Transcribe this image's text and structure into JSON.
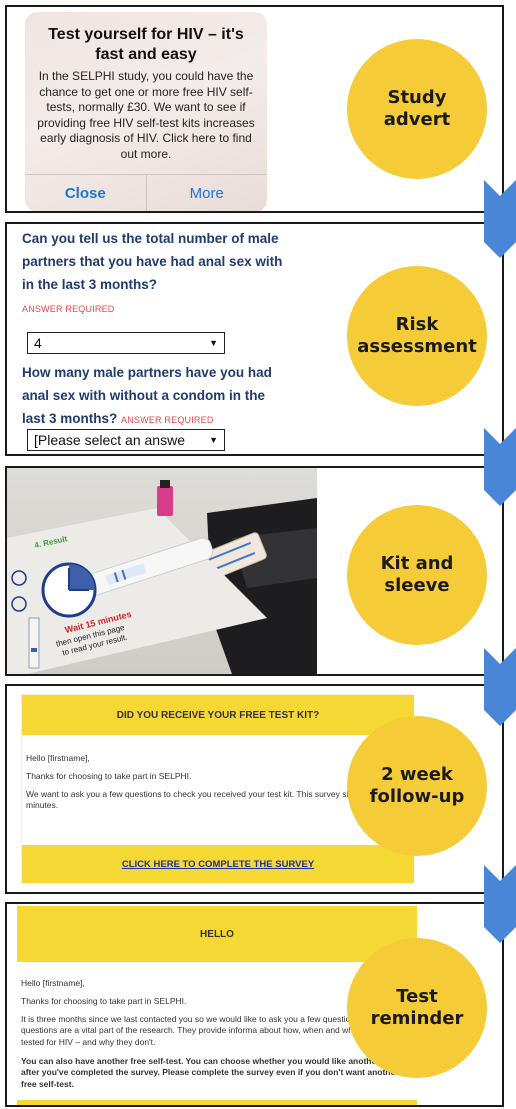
{
  "stages": [
    {
      "label_line1": "Study",
      "label_line2": "advert"
    },
    {
      "label_line1": "Risk",
      "label_line2": "assessment"
    },
    {
      "label_line1": "Kit and",
      "label_line2": "sleeve"
    },
    {
      "label_line1": "2 week",
      "label_line2": "follow-up"
    },
    {
      "label_line1": "Test",
      "label_line2": "reminder"
    }
  ],
  "advert": {
    "title": "Test yourself for HIV – it's fast and easy",
    "body": "In the SELPHI study, you could have the chance to get one or more free HIV self-tests, normally £30. We want to see if providing free HIV self-test kits increases early diagnosis of HIV. Click here to find out more.",
    "close_label": "Close",
    "more_label": "More"
  },
  "risk": {
    "q1": "Can you tell us the total number of male partners that you have had anal sex with in the last 3 months?",
    "q1_required": "ANSWER REQUIRED",
    "q1_value": "4",
    "q2": "How many male partners have you had anal sex with without a condom in the last 3 months?",
    "q2_required": "ANSWER REQUIRED",
    "q2_value": "[Please select an answe"
  },
  "kit": {
    "step_label": "4. Result",
    "wait_text": "Wait 15 minutes",
    "then_text": "then open this page",
    "read_text": "to read your result."
  },
  "followup": {
    "header": "DID YOU RECEIVE YOUR FREE TEST KIT?",
    "greeting": "Hello [firstname],",
    "thanks": "Thanks for choosing to take part in SELPHI.",
    "body": "We want to ask you a few questions to check you received your test kit. This survey sho take 2-3 minutes.",
    "link": "CLICK HERE TO COMPLETE THE SURVEY"
  },
  "reminder": {
    "header": "HELLO",
    "greeting": "Hello [firstname],",
    "thanks": "Thanks for choosing to take part in SELPHI.",
    "body": "It is three months since we last contacted you so we would like to ask you a few questions. These questions are a vital part of the research. They provide informa about how, when and why people get tested for HIV – and why they don't.",
    "bold_body": "You can also have another free self-test. You can choose whether you would like another test after you've completed the survey. Please complete the survey even if you don't want another free self-test."
  },
  "colors": {
    "circle": "#f5cc38",
    "arrow": "#4a86d8",
    "email_bar": "#f6d834",
    "link": "#1f2fa0",
    "question": "#1f3b70",
    "required": "#e04a4a"
  }
}
